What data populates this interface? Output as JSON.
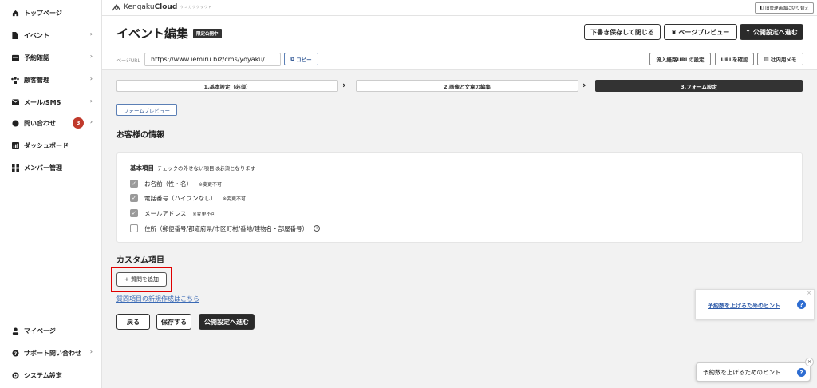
{
  "sidebar": {
    "items": [
      {
        "label": "トップページ",
        "icon": "home-icon",
        "chevron": false
      },
      {
        "label": "イベント",
        "icon": "document-icon",
        "chevron": true
      },
      {
        "label": "予約確認",
        "icon": "calendar-icon",
        "chevron": true
      },
      {
        "label": "顧客管理",
        "icon": "users-icon",
        "chevron": true
      },
      {
        "label": "メール/SMS",
        "icon": "mail-icon",
        "chevron": true
      },
      {
        "label": "問い合わせ",
        "icon": "chat-icon",
        "chevron": true,
        "badge": "3"
      },
      {
        "label": "ダッシュボード",
        "icon": "chart-icon",
        "chevron": false
      },
      {
        "label": "メンバー管理",
        "icon": "grid-icon",
        "chevron": false
      }
    ],
    "bottom_items": [
      {
        "label": "マイページ",
        "icon": "person-icon",
        "chevron": false
      },
      {
        "label": "サポート問い合わせ",
        "icon": "help-icon",
        "chevron": true
      },
      {
        "label": "システム設定",
        "icon": "gear-icon",
        "chevron": false
      }
    ]
  },
  "topbar": {
    "logo_text": "Kengaku",
    "logo_bold": "Cloud",
    "logo_sub": "ケンガククラウド",
    "switch_label": "旧管理画面に切り替え"
  },
  "header": {
    "title": "イベント編集",
    "tag": "限定公開中",
    "save_close": "下書き保存して閉じる",
    "preview": "ページプレビュー",
    "publish": "公開設定へ進む"
  },
  "url_row": {
    "label": "ページURL",
    "url": "https://www.iemiru.biz/cms/yoyaku/",
    "copy": "コピー",
    "inflow": "流入経路URLの設定",
    "check": "URLを確認",
    "memo": "社内用メモ"
  },
  "steps": [
    {
      "label": "1.基本設定（必須）",
      "active": false
    },
    {
      "label": "2.画像と文章の編集",
      "active": false
    },
    {
      "label": "3.フォーム設定",
      "active": true
    }
  ],
  "form": {
    "preview_button": "フォームプレビュー",
    "customer_title": "お客様の情報",
    "basic_title": "基本項目",
    "basic_note": "チェックの外せない項目は必須となります",
    "fields": [
      {
        "label": "お名前（性・名）",
        "note": "※変更不可",
        "checked": true
      },
      {
        "label": "電話番号（ハイフンなし）",
        "note": "※変更不可",
        "checked": true
      },
      {
        "label": "メールアドレス",
        "note": "※変更不可",
        "checked": true
      },
      {
        "label": "住所（郵便番号/都道府県/市区町村/番地/建物名・部屋番号）",
        "note": "",
        "checked": false
      }
    ],
    "custom_title": "カスタム項目",
    "add_question": "+ 質問を追加",
    "new_link": "質問項目の新規作成はこちら"
  },
  "footer_buttons": {
    "back": "戻る",
    "save": "保存する",
    "next": "公開設定へ進む"
  },
  "hints": {
    "hint_link": "予約数を上げるためのヒント",
    "hint_button": "予約数を上げるためのヒント"
  }
}
